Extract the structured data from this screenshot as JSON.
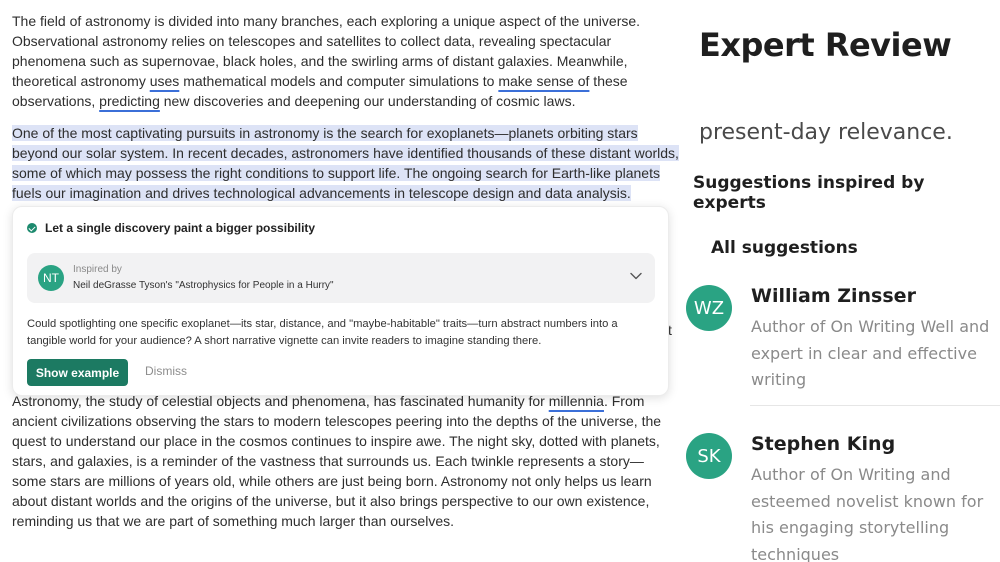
{
  "document": {
    "p1_a": "The field of astronomy is divided into many branches, each exploring a unique aspect of the universe. Observational astronomy relies on telescopes and satellites to collect data, revealing spectacular phenomena such as supernovae, black holes, and the swirling arms of distant galaxies. Meanwhile, theoretical astronomy ",
    "p1_uses": "uses",
    "p1_b": " mathematical models and computer simulations to ",
    "p1_make_sense": "make sense of",
    "p1_c": " these observations, ",
    "p1_predicting": "predicting",
    "p1_d": " new discoveries and deepening our understanding of cosmic laws.",
    "p2": "One of the most captivating pursuits in astronomy is the search for exoplanets—planets orbiting stars beyond our solar system. In recent decades, astronomers have identified thousands of these distant worlds, some of which may possess the right conditions to support life. The ongoing search for Earth-like planets fuels our imagination and drives technological advancements in telescope design and data analysis.",
    "p3_a": "Astronomy, the study of celestial objects and phenomena, has fascinated humanity for ",
    "p3_millennia": "millennia",
    "p3_b": ". From ancient civilizations observing the stars to modern telescopes peering into the depths of the universe, the quest to understand our place in the cosmos continues to inspire awe. The night sky, dotted with planets, stars, and galaxies, is a reminder of the vastness that surrounds us. Each twinkle represents a story—some stars are millions of years old, while others are just being born. Astronomy not only helps us learn about distant worlds and the origins of the universe, but it also brings perspective to our own existence, reminding us that we are part of something much larger than ourselves.",
    "edge_char": "t"
  },
  "card": {
    "title": "Let a single discovery paint a bigger possibility",
    "avatar": "NT",
    "inspired_label": "Inspired by",
    "inspired_source": "Neil deGrasse Tyson's \"Astrophysics for People in a Hurry\"",
    "body": "Could spotlighting one specific exoplanet—its star, distance, and \"maybe-habitable\" traits—turn abstract numbers into a tangible world for your audience? A short narrative vignette can invite readers to imagine standing there.",
    "show_example": "Show example",
    "dismiss": "Dismiss"
  },
  "panel": {
    "title": "Expert Review",
    "snippet": "present-day relevance.",
    "suggestions_heading": "Suggestions inspired by experts",
    "all_suggestions": "All suggestions",
    "experts": [
      {
        "initials": "WZ",
        "name": "William Zinsser",
        "desc": "Author of On Writing Well and expert in clear and effective writing"
      },
      {
        "initials": "SK",
        "name": "Stephen King",
        "desc": "Author of On Writing and esteemed novelist known for his engaging storytelling techniques"
      }
    ]
  },
  "colors": {
    "highlight": "#dde3f6",
    "underline": "#3b6fd8",
    "accent_green": "#1c7a62",
    "avatar_green": "#2aa383"
  },
  "icons": {
    "card_status": "check-circle-icon",
    "expand": "chevron-down-icon"
  }
}
